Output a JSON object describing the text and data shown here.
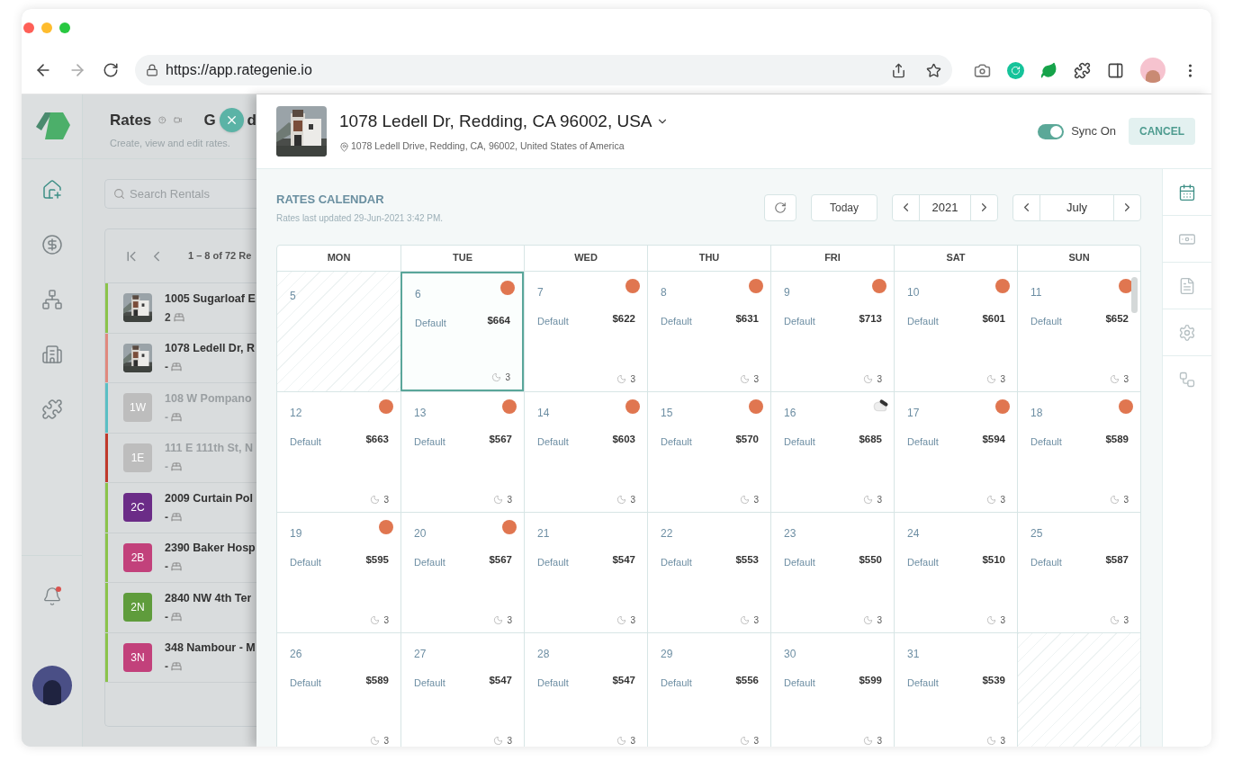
{
  "browser": {
    "url": "https://app.rategenie.io"
  },
  "app_header": {
    "title": "Rates",
    "subtitle": "Create, view and edit rates.",
    "next_title": [
      "G",
      "d"
    ]
  },
  "sidebar": {
    "items": [
      {
        "selected": true
      },
      {
        "selected": false
      },
      {
        "selected": false
      },
      {
        "selected": false
      },
      {
        "selected": false
      }
    ],
    "notifications": {
      "unread": true
    }
  },
  "search": {
    "placeholder": "Search Rentals"
  },
  "pagination": {
    "range": "1 – 8 of 72 Re"
  },
  "rentals": [
    {
      "title": "1005 Sugarloaf E",
      "beds": "2",
      "color": "#8bc34a",
      "disabled": false
    },
    {
      "title": "1078 Ledell Dr, R",
      "beds": "-",
      "color": "#e0897e",
      "disabled": false
    },
    {
      "title": "108 W Pompano",
      "beds": "-",
      "color": "#5bbfc4",
      "thumb": {
        "kind": "badge",
        "text": "1W",
        "color": "#bdbdbd"
      },
      "disabled": true
    },
    {
      "title": "111 E 111th St, N",
      "beds": "-",
      "color": "#c0392b",
      "thumb": {
        "kind": "badge",
        "text": "1E",
        "color": "#bdbdbd"
      },
      "disabled": true
    },
    {
      "title": "2009 Curtain Pol",
      "beds": "-",
      "color": "#8bc34a",
      "thumb": {
        "kind": "badge",
        "text": "2C",
        "color": "#6b2c87"
      },
      "disabled": false
    },
    {
      "title": "2390 Baker Hosp",
      "beds": "-",
      "color": "#8bc34a",
      "thumb": {
        "kind": "badge",
        "text": "2B",
        "color": "#c2417b"
      },
      "disabled": false
    },
    {
      "title": "2840 NW 4th Ter",
      "beds": "-",
      "color": "#8bc34a",
      "thumb": {
        "kind": "badge",
        "text": "2N",
        "color": "#5f9c3c"
      },
      "disabled": false
    },
    {
      "title": "348 Nambour - M",
      "beds": "-",
      "color": "#8bc34a",
      "thumb": {
        "kind": "badge",
        "text": "3N",
        "color": "#c2417b"
      },
      "disabled": false
    }
  ],
  "listing": {
    "title": "1078 Ledell Dr, Redding, CA 96002, USA",
    "address": "1078 Ledell Drive, Redding, CA, 96002, United States of America",
    "sync": {
      "label": "Sync On",
      "on": true
    },
    "cancel": "CANCEL"
  },
  "rail": {
    "items": [
      {
        "selected": true
      },
      {
        "selected": false
      },
      {
        "selected": false
      },
      {
        "selected": false
      },
      {
        "selected": false
      }
    ]
  },
  "calendar": {
    "title": "RATES CALENDAR",
    "updated": "Rates last updated 29-Jun-2021 3:42 PM.",
    "today": "Today",
    "year": "2021",
    "month": "July",
    "weekdays": [
      "MON",
      "TUE",
      "WED",
      "THU",
      "FRI",
      "SAT",
      "SUN"
    ],
    "weeks": [
      [
        {
          "kind": "past",
          "day": "5"
        },
        {
          "kind": "rate",
          "day": "6",
          "label": "Default",
          "price": "$664",
          "nights": "3",
          "indicator": {
            "kind": "dot"
          },
          "selected": true
        },
        {
          "kind": "rate",
          "day": "7",
          "label": "Default",
          "price": "$622",
          "nights": "3",
          "indicator": {
            "kind": "dot"
          },
          "selected": false
        },
        {
          "kind": "rate",
          "day": "8",
          "label": "Default",
          "price": "$631",
          "nights": "3",
          "indicator": {
            "kind": "dot"
          },
          "selected": false
        },
        {
          "kind": "rate",
          "day": "9",
          "label": "Default",
          "price": "$713",
          "nights": "3",
          "indicator": {
            "kind": "dot"
          },
          "selected": false
        },
        {
          "kind": "rate",
          "day": "10",
          "label": "Default",
          "price": "$601",
          "nights": "3",
          "indicator": {
            "kind": "dot"
          },
          "selected": false
        },
        {
          "kind": "rate",
          "day": "11",
          "label": "Default",
          "price": "$652",
          "nights": "3",
          "indicator": {
            "kind": "dot"
          },
          "selected": false
        }
      ],
      [
        {
          "kind": "rate",
          "day": "12",
          "label": "Default",
          "price": "$663",
          "nights": "3",
          "indicator": {
            "kind": "dot"
          },
          "selected": false
        },
        {
          "kind": "rate",
          "day": "13",
          "label": "Default",
          "price": "$567",
          "nights": "3",
          "indicator": {
            "kind": "dot"
          },
          "selected": false
        },
        {
          "kind": "rate",
          "day": "14",
          "label": "Default",
          "price": "$603",
          "nights": "3",
          "indicator": {
            "kind": "dot"
          },
          "selected": false
        },
        {
          "kind": "rate",
          "day": "15",
          "label": "Default",
          "price": "$570",
          "nights": "3",
          "indicator": {
            "kind": "dot"
          },
          "selected": false
        },
        {
          "kind": "rate",
          "day": "16",
          "label": "Default",
          "price": "$685",
          "nights": "3",
          "indicator": {
            "kind": "cloud"
          },
          "selected": false
        },
        {
          "kind": "rate",
          "day": "17",
          "label": "Default",
          "price": "$594",
          "nights": "3",
          "indicator": {
            "kind": "dot"
          },
          "selected": false
        },
        {
          "kind": "rate",
          "day": "18",
          "label": "Default",
          "price": "$589",
          "nights": "3",
          "indicator": {
            "kind": "dot"
          },
          "selected": false
        }
      ],
      [
        {
          "kind": "rate",
          "day": "19",
          "label": "Default",
          "price": "$595",
          "nights": "3",
          "indicator": {
            "kind": "dot"
          },
          "selected": false
        },
        {
          "kind": "rate",
          "day": "20",
          "label": "Default",
          "price": "$567",
          "nights": "3",
          "indicator": {
            "kind": "dot"
          },
          "selected": false
        },
        {
          "kind": "rate",
          "day": "21",
          "label": "Default",
          "price": "$547",
          "nights": "3",
          "selected": false
        },
        {
          "kind": "rate",
          "day": "22",
          "label": "Default",
          "price": "$553",
          "nights": "3",
          "selected": false
        },
        {
          "kind": "rate",
          "day": "23",
          "label": "Default",
          "price": "$550",
          "nights": "3",
          "selected": false
        },
        {
          "kind": "rate",
          "day": "24",
          "label": "Default",
          "price": "$510",
          "nights": "3",
          "selected": false
        },
        {
          "kind": "rate",
          "day": "25",
          "label": "Default",
          "price": "$587",
          "nights": "3",
          "selected": false
        }
      ],
      [
        {
          "kind": "rate",
          "day": "26",
          "label": "Default",
          "price": "$589",
          "nights": "3",
          "selected": false
        },
        {
          "kind": "rate",
          "day": "27",
          "label": "Default",
          "price": "$547",
          "nights": "3",
          "selected": false
        },
        {
          "kind": "rate",
          "day": "28",
          "label": "Default",
          "price": "$547",
          "nights": "3",
          "selected": false
        },
        {
          "kind": "rate",
          "day": "29",
          "label": "Default",
          "price": "$556",
          "nights": "3",
          "selected": false
        },
        {
          "kind": "rate",
          "day": "30",
          "label": "Default",
          "price": "$599",
          "nights": "3",
          "selected": false
        },
        {
          "kind": "rate",
          "day": "31",
          "label": "Default",
          "price": "$539",
          "nights": "3",
          "selected": false
        },
        {
          "kind": "empty"
        }
      ]
    ]
  }
}
